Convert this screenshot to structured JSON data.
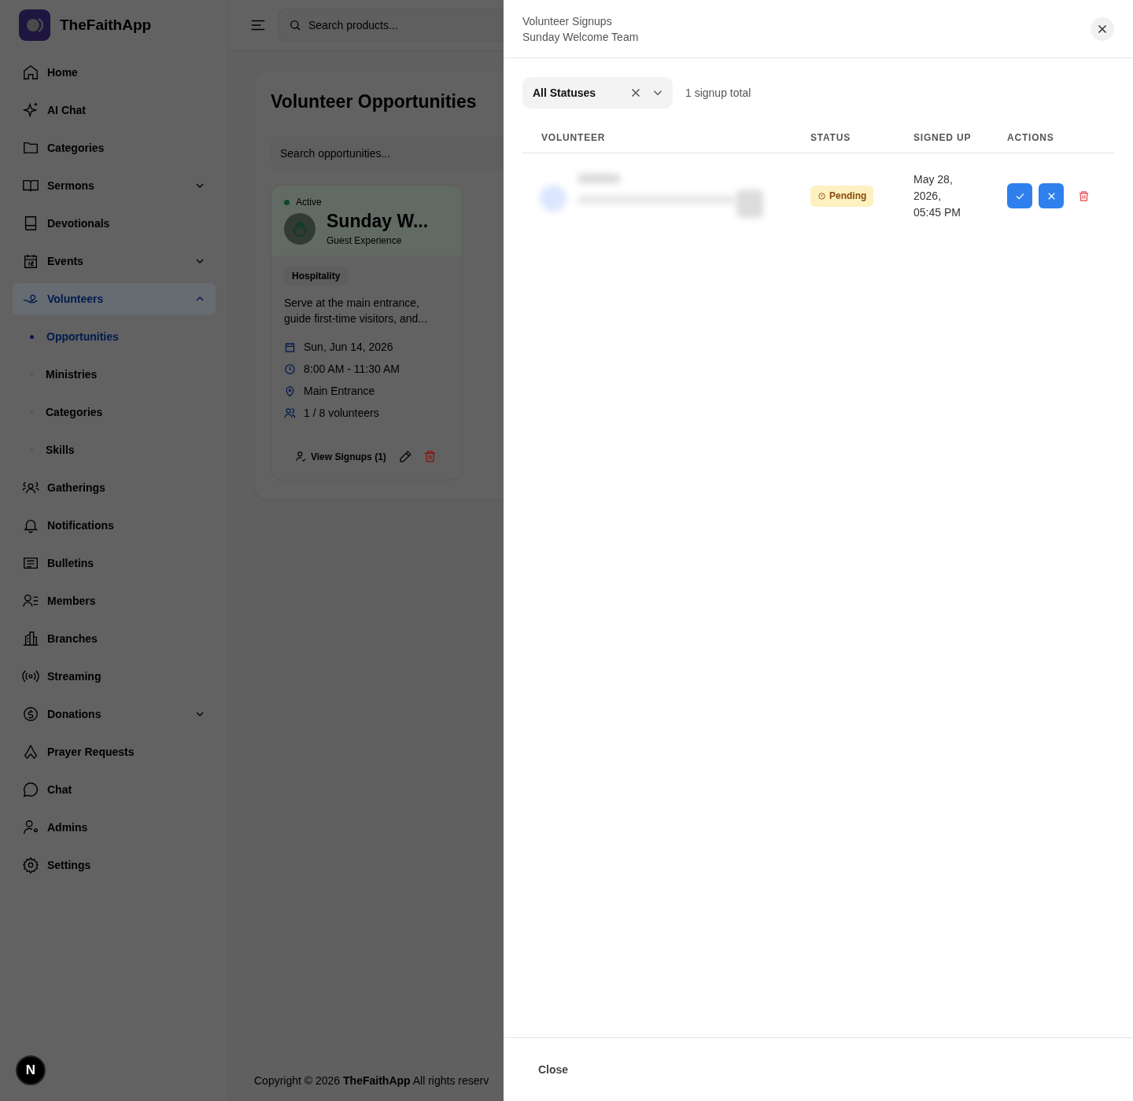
{
  "app": {
    "name": "TheFaithApp",
    "dev_badge": "N"
  },
  "sidebar": {
    "items": [
      {
        "label": "Home",
        "kind": "link",
        "selected": false
      },
      {
        "label": "AI Chat",
        "kind": "link",
        "selected": false
      },
      {
        "label": "Categories",
        "kind": "link",
        "selected": false
      },
      {
        "label": "Sermons",
        "kind": "group",
        "expanded": false,
        "selected": false
      },
      {
        "label": "Devotionals",
        "kind": "link",
        "selected": false
      },
      {
        "label": "Events",
        "kind": "group",
        "expanded": false,
        "selected": false
      },
      {
        "label": "Volunteers",
        "kind": "group",
        "expanded": true,
        "selected": true,
        "children": [
          {
            "label": "Opportunities",
            "selected": true
          },
          {
            "label": "Ministries",
            "selected": false
          },
          {
            "label": "Categories",
            "selected": false
          },
          {
            "label": "Skills",
            "selected": false
          }
        ]
      },
      {
        "label": "Gatherings",
        "kind": "link",
        "selected": false
      },
      {
        "label": "Notifications",
        "kind": "link",
        "selected": false
      },
      {
        "label": "Bulletins",
        "kind": "link",
        "selected": false
      },
      {
        "label": "Members",
        "kind": "link",
        "selected": false
      },
      {
        "label": "Branches",
        "kind": "link",
        "selected": false
      },
      {
        "label": "Streaming",
        "kind": "link",
        "selected": false
      },
      {
        "label": "Donations",
        "kind": "group",
        "expanded": false,
        "selected": false
      },
      {
        "label": "Prayer Requests",
        "kind": "link",
        "selected": false
      },
      {
        "label": "Chat",
        "kind": "link",
        "selected": false
      },
      {
        "label": "Admins",
        "kind": "link",
        "selected": false
      },
      {
        "label": "Settings",
        "kind": "link",
        "selected": false
      }
    ]
  },
  "header": {
    "search": {
      "placeholder": "Search products..."
    }
  },
  "page": {
    "title": "Volunteer Opportunities",
    "search": {
      "placeholder": "Search opportunities..."
    },
    "cards": [
      {
        "status": "Active",
        "title": "Sunday W...",
        "subtitle": "Guest Experience",
        "tag": "Hospitality",
        "description": "Serve at the main entrance, guide first-time visitors, and...",
        "details": [
          "Sun, Jun 14, 2026",
          "8:00 AM - 11:30 AM",
          "Main Entrance",
          "1 / 8 volunteers"
        ],
        "view_button": "View Signups (1)"
      }
    ]
  },
  "footer": {
    "copyright": "Copyright © 2026 **TheFaithApp** All rights reserv"
  },
  "drawer": {
    "title": "Volunteer Signups",
    "subtitle": "Sunday Welcome Team",
    "filter": {
      "value": "All Statuses"
    },
    "total": "1 signup total",
    "table": {
      "columns": [
        "VOLUNTEER",
        "STATUS",
        "SIGNED UP",
        "ACTIONS"
      ],
      "rows": [
        {
          "status": {
            "label": "Pending",
            "kind": "pending"
          },
          "signed_up": "May 28, 2026, 05:45 PM"
        }
      ]
    },
    "close_button": "Close"
  }
}
